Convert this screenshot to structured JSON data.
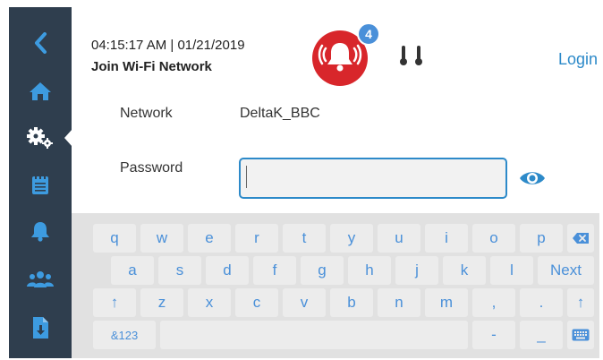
{
  "header": {
    "datetime": "04:15:17 AM | 01/21/2019",
    "title": "Join Wi-Fi Network",
    "alarm_count": "4",
    "login_label": "Login"
  },
  "sidebar": {
    "items": [
      {
        "icon": "back-arrow-icon"
      },
      {
        "icon": "home-icon"
      },
      {
        "icon": "settings-gears-icon"
      },
      {
        "icon": "notepad-icon"
      },
      {
        "icon": "bell-icon"
      },
      {
        "icon": "users-icon"
      },
      {
        "icon": "document-download-icon"
      }
    ],
    "active_index": 2
  },
  "form": {
    "network_label": "Network",
    "network_value": "DeltaK_BBC",
    "password_label": "Password",
    "password_value": ""
  },
  "keyboard": {
    "row1": [
      "q",
      "w",
      "e",
      "r",
      "t",
      "y",
      "u",
      "i",
      "o",
      "p"
    ],
    "row2": [
      "a",
      "s",
      "d",
      "f",
      "g",
      "h",
      "j",
      "k",
      "l"
    ],
    "row3": [
      "z",
      "x",
      "c",
      "v",
      "b",
      "n",
      "m",
      ",",
      "."
    ],
    "next_label": "Next",
    "symbols_label": "&123",
    "dash_label": "-",
    "underscore_label": "_",
    "shift_glyph": "↑"
  },
  "colors": {
    "sidebar": "#2f3e4e",
    "accent": "#2d8ac9",
    "key_text": "#4a90d9",
    "alarm": "#d8262b"
  }
}
